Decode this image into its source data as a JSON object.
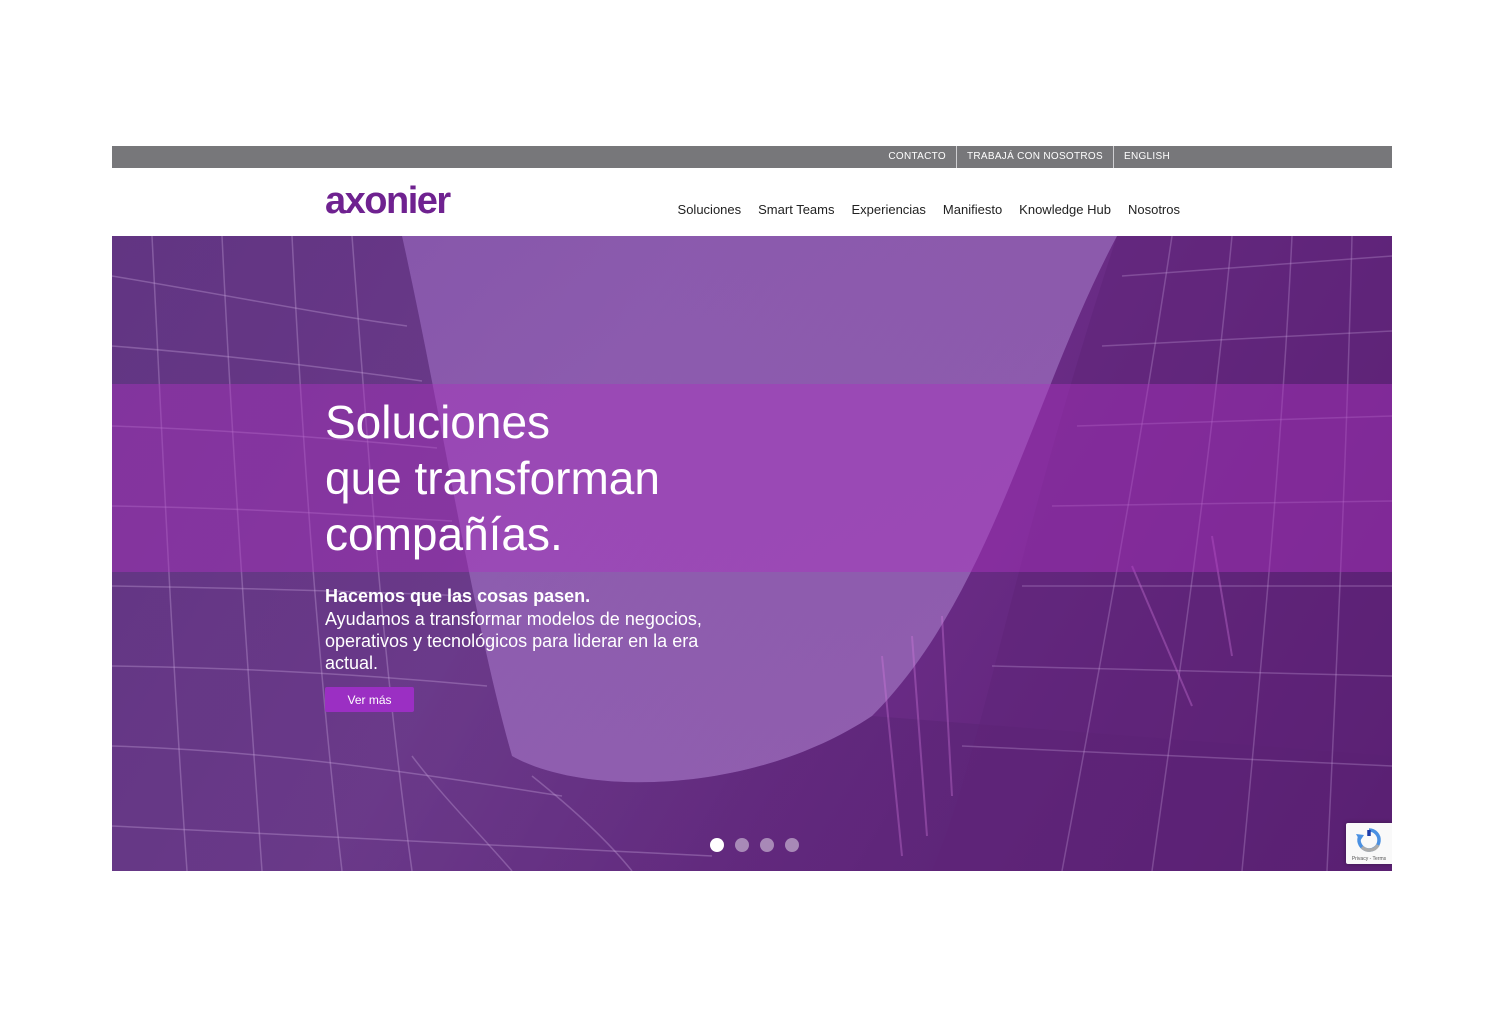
{
  "utility_nav": [
    "CONTACTO",
    "TRABAJÁ CON NOSOTROS",
    "ENGLISH"
  ],
  "brand": {
    "logo_text": "axonier",
    "color": "#6f2290"
  },
  "main_nav": [
    "Soluciones",
    "Smart Teams",
    "Experiencias",
    "Manifiesto",
    "Knowledge Hub",
    "Nosotros"
  ],
  "hero": {
    "title_lines": [
      "Soluciones",
      "que transforman",
      "compañías."
    ],
    "lead": "Hacemos que las cosas pasen.",
    "body": "Ayudamos a transformar modelos de negocios, operativos y tecnológicos para liderar en la era actual.",
    "cta_label": "Ver más",
    "cta_color": "#9b2fc3"
  },
  "slider": {
    "count": 4,
    "active": 1
  },
  "recaptcha": {
    "terms": "Privacy - Terms"
  }
}
